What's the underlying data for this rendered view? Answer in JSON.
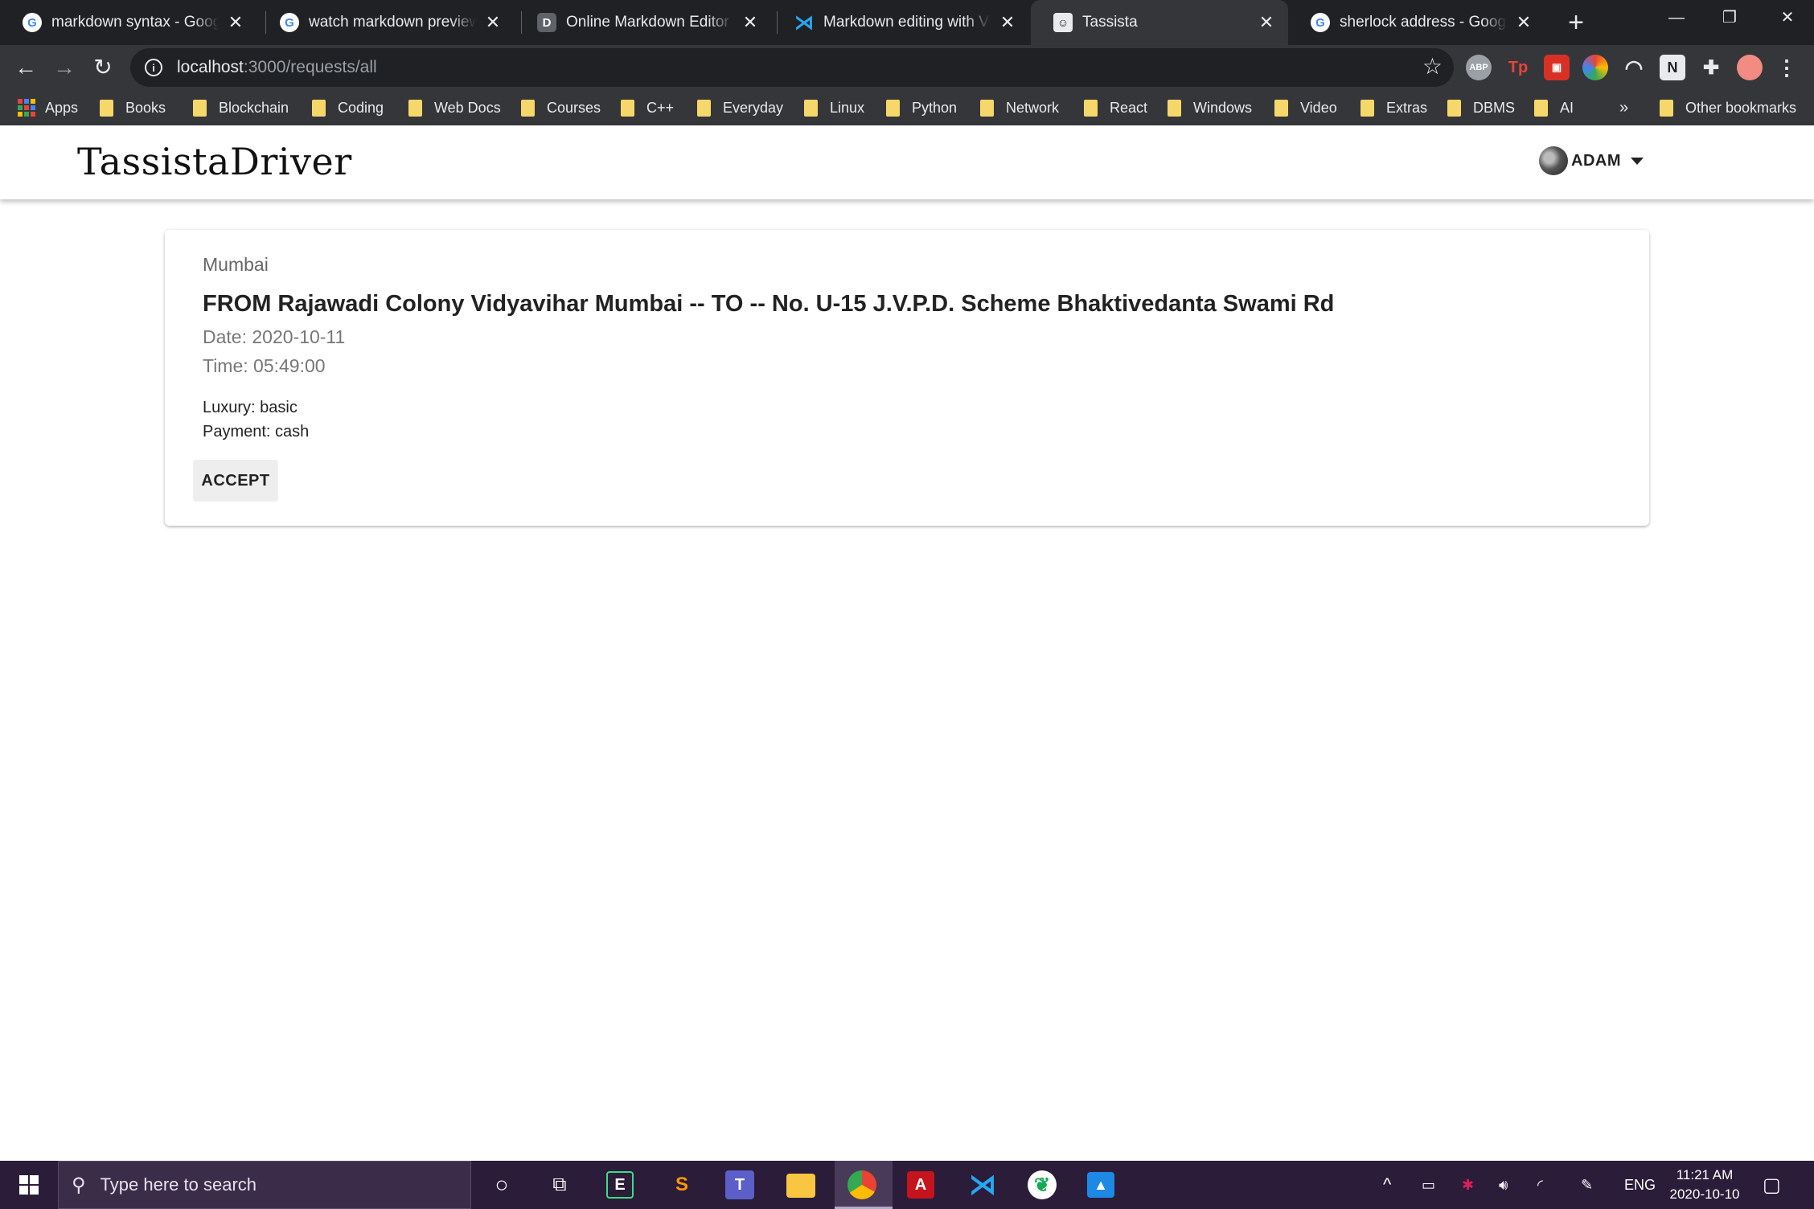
{
  "browser": {
    "tabs": [
      {
        "title": "markdown syntax - Google",
        "favicon": "google-icon",
        "active": false
      },
      {
        "title": "watch markdown preview - ",
        "favicon": "google-icon",
        "active": false
      },
      {
        "title": "Online Markdown Editor - D",
        "favicon": "dillinger-icon",
        "active": false
      },
      {
        "title": "Markdown editing with Visu",
        "favicon": "vscode-icon",
        "active": false
      },
      {
        "title": "Tassista",
        "favicon": "tassista-icon",
        "active": true
      },
      {
        "title": "sherlock address - Google S",
        "favicon": "google-icon",
        "active": false
      }
    ],
    "url": {
      "host": "localhost",
      "path": ":3000/requests/all"
    },
    "bookmarks": [
      "Apps",
      "Books",
      "Blockchain",
      "Coding",
      "Web Docs",
      "Courses",
      "C++",
      "Everyday",
      "Linux",
      "Python",
      "Network",
      "React",
      "Windows",
      "Video",
      "Extras",
      "DBMS",
      "AI"
    ],
    "bookmarks_overflow": "»",
    "other_bookmarks": "Other bookmarks",
    "extensions": [
      "ABP",
      "Tp"
    ]
  },
  "app": {
    "brand": "TassistaDriver",
    "user_name": "ADAM"
  },
  "request": {
    "city": "Mumbai",
    "route": "FROM Rajawadi Colony Vidyavihar Mumbai -- TO -- No. U-15 J.V.P.D. Scheme Bhaktivedanta Swami Rd",
    "date": "Date: 2020-10-11",
    "time": "Time: 05:49:00",
    "luxury": "Luxury: basic",
    "payment": "Payment: cash",
    "accept_label": "ACCEPT"
  },
  "taskbar": {
    "search_placeholder": "Type here to search",
    "language": "ENG",
    "time": "11:21 AM",
    "date": "2020-10-10"
  },
  "colors": {
    "chrome_dark": "#202124",
    "chrome_toolbar": "#35363a",
    "taskbar": "#2b1c3a",
    "folder": "#f6d86a"
  }
}
